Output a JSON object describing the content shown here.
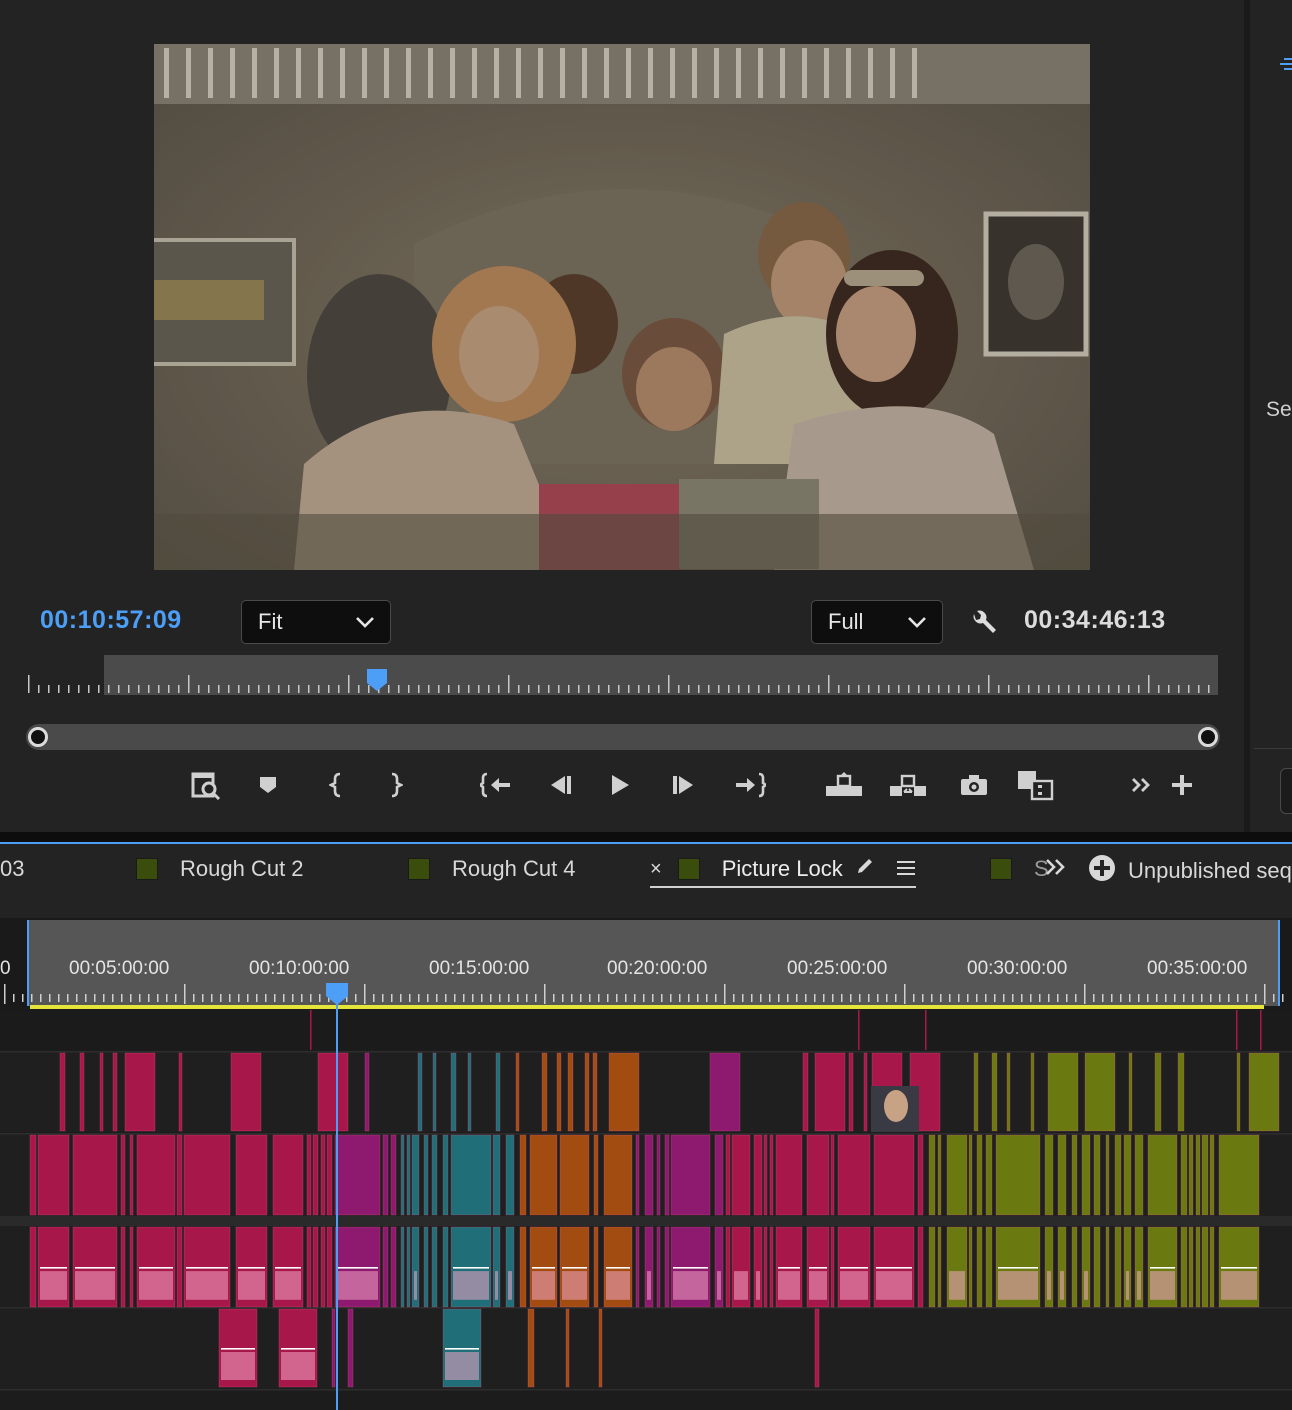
{
  "monitor": {
    "current_timecode": "00:10:57:09",
    "duration_timecode": "00:34:46:13",
    "zoom_value": "Fit",
    "resolution_value": "Full",
    "playhead_fraction": 0.245
  },
  "transport": {
    "buttons": [
      {
        "name": "export-frame-search-icon"
      },
      {
        "name": "add-marker-icon"
      },
      {
        "name": "mark-in-icon"
      },
      {
        "name": "mark-out-icon"
      },
      {
        "name": "go-to-in-icon"
      },
      {
        "name": "step-back-icon"
      },
      {
        "name": "play-icon"
      },
      {
        "name": "step-forward-icon"
      },
      {
        "name": "go-to-out-icon"
      },
      {
        "name": "lift-icon"
      },
      {
        "name": "extract-icon"
      },
      {
        "name": "export-frame-icon"
      },
      {
        "name": "comparison-view-icon"
      },
      {
        "name": "more-icon"
      },
      {
        "name": "add-button-icon"
      }
    ]
  },
  "right_panel": {
    "partial_label": "Sel"
  },
  "sequence_tabs": {
    "first_partial": "03",
    "tabs": [
      {
        "label": "Rough Cut 2",
        "color": "#3b4d0d"
      },
      {
        "label": "Rough Cut 4",
        "color": "#3b4d0d"
      },
      {
        "label": "Picture Lock",
        "color": "#3b4d0d",
        "active": true
      },
      {
        "label": "S",
        "color": "#3b4d0d"
      }
    ],
    "close_glyph": "×",
    "unpublished_label": "Unpublished seq"
  },
  "timeline": {
    "ruler_labels": [
      "00:05:00:00",
      "00:10:00:00",
      "00:15:00:00",
      "00:20:00:00",
      "00:25:00:00",
      "00:30:00:00",
      "00:35:00:00"
    ],
    "left_partial_label": "0",
    "playhead_timecode": "00:10:57:09"
  },
  "colors": {
    "accent_blue": "#4c9ef6",
    "work_area_yellow": "#e4e43a",
    "clip_rose": "#a8174a",
    "clip_teal": "#1f6e78",
    "clip_orange": "#a34c12",
    "clip_magenta": "#8d1a6e",
    "clip_olive": "#6b7a10",
    "clip_blue": "#2e49b5"
  }
}
